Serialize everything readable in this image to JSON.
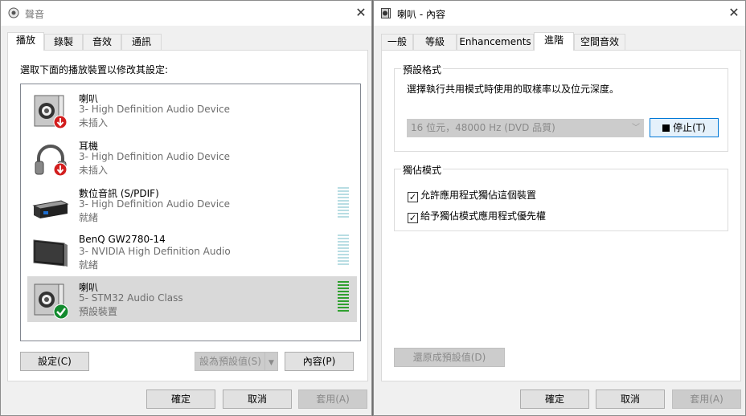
{
  "left_window": {
    "title": "聲音",
    "tabs": [
      "播放",
      "錄製",
      "音效",
      "通訊"
    ],
    "instruction": "選取下面的播放裝置以修改其設定:",
    "devices": [
      {
        "name": "喇叭",
        "description": "3- High Definition Audio Device",
        "status": "未插入",
        "icon": "speaker-icon",
        "badge": "unplugged-badge"
      },
      {
        "name": "耳機",
        "description": "3- High Definition Audio Device",
        "status": "未插入",
        "icon": "headphones-icon",
        "badge": "unplugged-badge"
      },
      {
        "name": "數位音訊 (S/PDIF)",
        "description": "3- High Definition Audio Device",
        "status": "就緒",
        "icon": "digital-audio-icon"
      },
      {
        "name": "BenQ GW2780-14",
        "description": "3- NVIDIA High Definition Audio",
        "status": "就緒",
        "icon": "monitor-icon"
      },
      {
        "name": "喇叭",
        "description": "5- STM32 Audio Class",
        "status": "預設裝置",
        "icon": "speaker-icon",
        "badge": "default-check-badge",
        "selected": true
      }
    ],
    "buttons": {
      "configure": "設定(C)",
      "set_default": "設為預設值(S)",
      "properties": "內容(P)",
      "ok": "確定",
      "cancel": "取消",
      "apply": "套用(A)"
    }
  },
  "right_window": {
    "title": "喇叭 - 內容",
    "tabs": [
      "一般",
      "等級",
      "Enhancements",
      "進階",
      "空間音效"
    ],
    "active_tab": "進階",
    "default_format": {
      "title": "預設格式",
      "description": "選擇執行共用模式時使用的取樣率以及位元深度。",
      "selected": "16 位元，48000 Hz (DVD 品質)",
      "stop_button": "停止(T)"
    },
    "exclusive_mode": {
      "title": "獨佔模式",
      "allow_exclusive": "允許應用程式獨佔這個裝置",
      "allow_exclusive_checked": true,
      "give_priority": "給予獨佔模式應用程式優先權",
      "give_priority_checked": true
    },
    "restore_defaults": "還原成預設值(D)",
    "buttons": {
      "ok": "確定",
      "cancel": "取消",
      "apply": "套用(A)"
    }
  }
}
